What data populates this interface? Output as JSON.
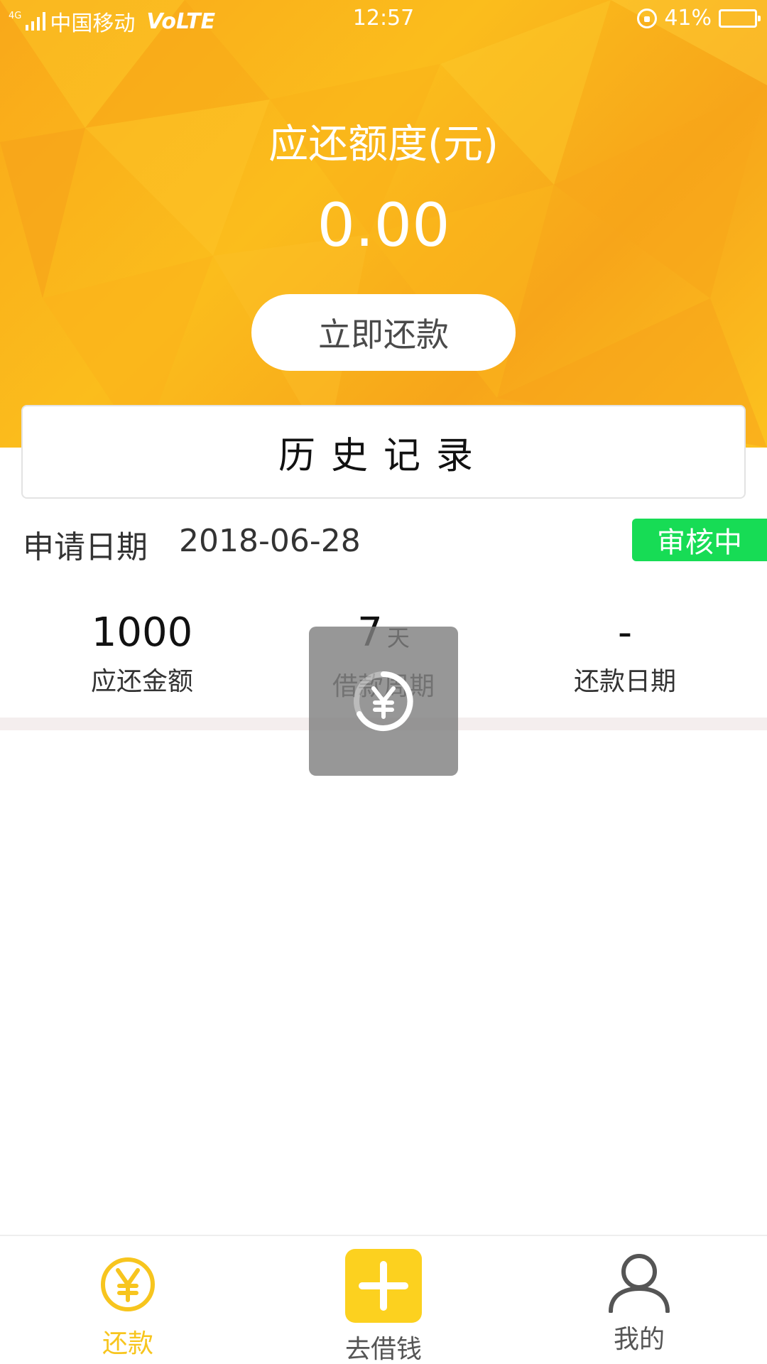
{
  "status_bar": {
    "network_type": "4G",
    "carrier": "中国移动",
    "volte": "VoLTE",
    "time": "12:57",
    "battery_percent": "41%",
    "battery_level": 0.41
  },
  "hero": {
    "title": "应还额度(元)",
    "amount": "0.00",
    "pay_button_label": "立即还款"
  },
  "history": {
    "title": "历史记录"
  },
  "record": {
    "date_label": "申请日期",
    "date_value": "2018-06-28",
    "status": "审核中",
    "stats": [
      {
        "value": "1000",
        "unit": "",
        "label": "应还金额"
      },
      {
        "value": "7",
        "unit": "天",
        "label": "借款周期"
      },
      {
        "value": "-",
        "unit": "",
        "label": "还款日期"
      }
    ]
  },
  "tabbar": {
    "items": [
      {
        "label": "还款",
        "icon": "yen-circle-icon",
        "active": true
      },
      {
        "label": "去借钱",
        "icon": "plus-icon",
        "active": false
      },
      {
        "label": "我的",
        "icon": "user-icon",
        "active": false
      }
    ]
  },
  "colors": {
    "brand_yellow": "#fbbd1c",
    "badge_green": "#17dc55",
    "tab_active": "#f7c51e",
    "tab_inactive": "#555555"
  }
}
